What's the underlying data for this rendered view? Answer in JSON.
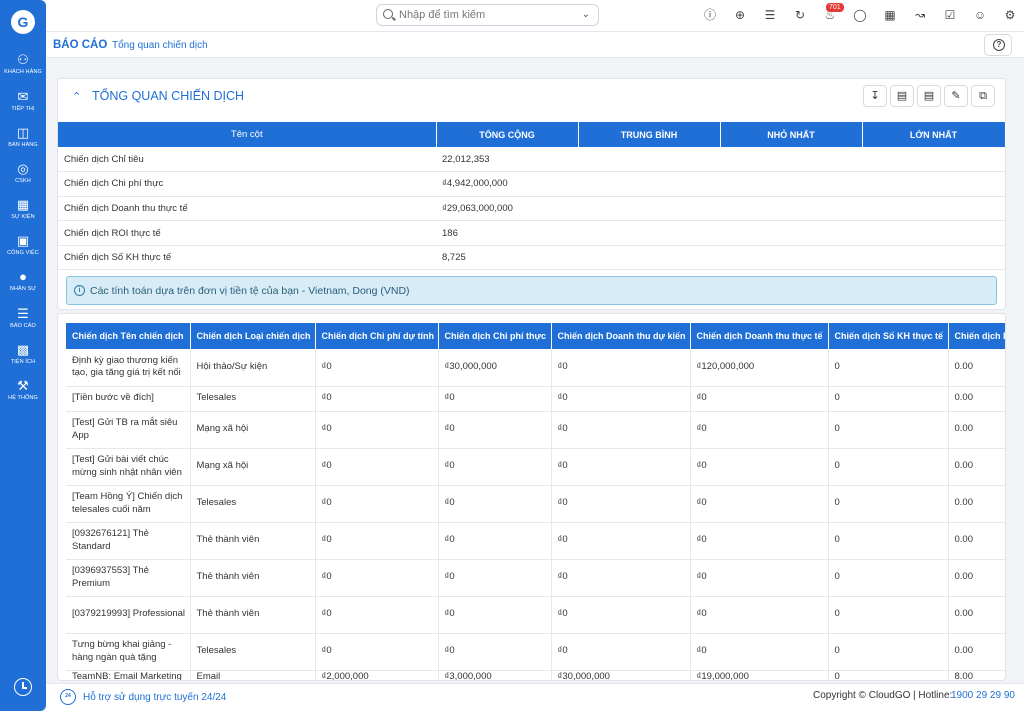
{
  "brand": {
    "logo": "G"
  },
  "sidebar": {
    "items": [
      {
        "label": "Khách hàng",
        "icon": "users-icon"
      },
      {
        "label": "Tiếp thị",
        "icon": "megaphone-icon"
      },
      {
        "label": "Bán hàng",
        "icon": "cart-icon"
      },
      {
        "label": "CSKH",
        "icon": "support-icon"
      },
      {
        "label": "Sự kiện",
        "icon": "calendar-icon"
      },
      {
        "label": "Công việc",
        "icon": "briefcase-icon"
      },
      {
        "label": "Nhân sự",
        "icon": "person-icon"
      },
      {
        "label": "Báo cáo",
        "icon": "report-icon"
      },
      {
        "label": "Tiện ích",
        "icon": "toolbox-icon"
      },
      {
        "label": "Hệ thống",
        "icon": "wrench-icon"
      }
    ]
  },
  "topbar": {
    "search_placeholder": "Nhập để tìm kiếm",
    "notification_count": "701"
  },
  "breadcrumb": {
    "root": "BÁO CÁO",
    "current": "Tổng quan chiến dịch"
  },
  "summary": {
    "title": "Tổng quan chiến dịch",
    "columns": [
      "Tên cột",
      "Tổng cộng",
      "Trung bình",
      "Nhỏ nhất",
      "Lớn nhất"
    ],
    "rows": [
      [
        "Chiến dịch Chỉ tiêu",
        "22,012,353",
        "",
        "",
        ""
      ],
      [
        "Chiến dịch Chi phí thực",
        "₫4,942,000,000",
        "",
        "",
        ""
      ],
      [
        "Chiến dịch Doanh thu thực tế",
        "₫29,063,000,000",
        "",
        "",
        ""
      ],
      [
        "Chiến dịch ROI thực tế",
        "186",
        "",
        "",
        ""
      ],
      [
        "Chiến dịch Số KH thực tế",
        "8,725",
        "",
        "",
        ""
      ]
    ],
    "notice": "Các tính toán dựa trên đơn vị tiền tệ của bạn - Vietnam, Dong (VND)"
  },
  "detail": {
    "columns": [
      "Chiến dịch Tên chiến dịch",
      "Chiến dịch Loại chiến dịch",
      "Chiến dịch Chi phí dự tính",
      "Chiến dịch Chi phí thực",
      "Chiến dịch Doanh thu dự kiến",
      "Chiến dịch Doanh thu thực tế",
      "Chiến dịch Số KH thực tế",
      "Chiến dịch ROI thực tế"
    ],
    "rows": [
      [
        "Định kỳ giao thương kiến tạo, gia tăng giá trị kết nối",
        "Hội thảo/Sự kiện",
        "₫0",
        "₫30,000,000",
        "₫0",
        "₫120,000,000",
        "0",
        "0.00"
      ],
      [
        "[Tiền bước về đích]",
        "Telesales",
        "₫0",
        "₫0",
        "₫0",
        "₫0",
        "0",
        "0.00"
      ],
      [
        "[Test] Gửi TB ra mắt siêu App",
        "Mạng xã hội",
        "₫0",
        "₫0",
        "₫0",
        "₫0",
        "0",
        "0.00"
      ],
      [
        "[Test] Gửi bài viết chúc mừng sinh nhật nhân viên",
        "Mạng xã hội",
        "₫0",
        "₫0",
        "₫0",
        "₫0",
        "0",
        "0.00"
      ],
      [
        "[Team Hồng Ý] Chiến dịch telesales cuối năm",
        "Telesales",
        "₫0",
        "₫0",
        "₫0",
        "₫0",
        "0",
        "0.00"
      ],
      [
        "[0932676121] Thẻ Standard",
        "Thẻ thành viên",
        "₫0",
        "₫0",
        "₫0",
        "₫0",
        "0",
        "0.00"
      ],
      [
        "[0396937553] Thẻ Premium",
        "Thẻ thành viên",
        "₫0",
        "₫0",
        "₫0",
        "₫0",
        "0",
        "0.00"
      ],
      [
        "[0379219993] Professional",
        "Thẻ thành viên",
        "₫0",
        "₫0",
        "₫0",
        "₫0",
        "0",
        "0.00"
      ],
      [
        "Tưng bừng khai giảng - hàng ngàn quà tặng",
        "Telesales",
        "₫0",
        "₫0",
        "₫0",
        "₫0",
        "0",
        "0.00"
      ],
      [
        "TeamNB: Email Marketing",
        "Email",
        "₫2,000,000",
        "₫3,000,000",
        "₫30,000,000",
        "₫19,000,000",
        "0",
        "8.00"
      ]
    ]
  },
  "footer": {
    "support": "Hỗ trợ sử dụng trực tuyến 24/24",
    "copyright": "Copyright © CloudGO",
    "hotline_label": "| Hotline:",
    "hotline_number": "1900 29 29 90"
  }
}
